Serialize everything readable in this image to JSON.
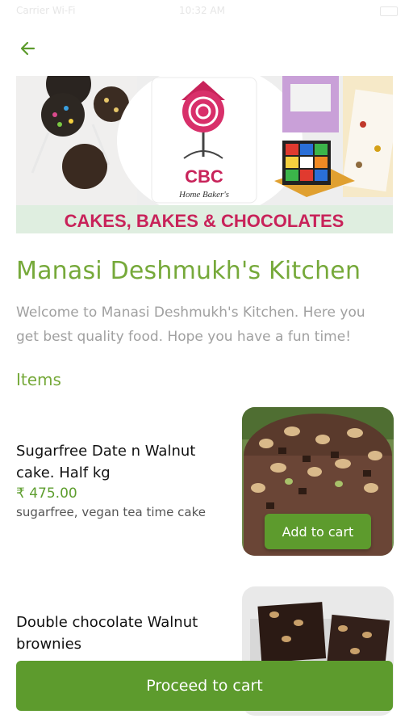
{
  "status_bar": {
    "left": "Carrier Wi-Fi",
    "time": "10:32 AM"
  },
  "banner": {
    "logo_text": "CBC",
    "logo_subtext": "Home Baker's",
    "tagline": "CAKES, BAKES & CHOCOLATES"
  },
  "shop": {
    "title": "Manasi Deshmukh's Kitchen",
    "description": "Welcome to Manasi Deshmukh's Kitchen. Here you get best quality food. Hope you have a fun time!"
  },
  "items_heading": "Items",
  "items": [
    {
      "name": "Sugarfree Date n Walnut cake. Half kg",
      "price": "₹ 475.00",
      "description": "sugarfree, vegan tea time cake",
      "button": "Add to cart"
    },
    {
      "name": "Double chocolate Walnut brownies",
      "price": "",
      "description": ""
    }
  ],
  "proceed_label": "Proceed to cart",
  "colors": {
    "brand_green": "#5d9b2d",
    "title_green": "#76a93a"
  }
}
